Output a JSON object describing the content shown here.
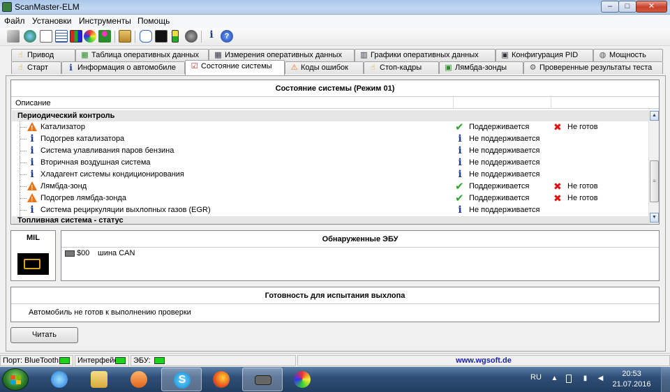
{
  "window": {
    "title": "ScanMaster-ELM",
    "min_glyph": "–",
    "max_glyph": "□",
    "close_glyph": "✕"
  },
  "menu": [
    "Файл",
    "Установки",
    "Инструменты",
    "Помощь"
  ],
  "toolbar_icons": [
    "wrench-icon",
    "globe-icon",
    "document-icon",
    "table-icon",
    "chart-icon",
    "gauge-icon",
    "person-icon",
    "clipboard-icon",
    "chat-icon",
    "terminal-icon",
    "battery-icon",
    "stop-icon",
    "info-icon",
    "help-icon"
  ],
  "tabs_top": [
    {
      "label": "Привод",
      "icon": "gear-hand-icon",
      "glyph": "☝"
    },
    {
      "label": "Таблица оперативных данных",
      "icon": "table-icon",
      "glyph": "▦"
    },
    {
      "label": "Измерения оперативных данных",
      "icon": "grid-icon",
      "glyph": "▦"
    },
    {
      "label": "Графики оперативных данных",
      "icon": "chart-icon",
      "glyph": "▥"
    },
    {
      "label": "Конфигурация PID",
      "icon": "config-icon",
      "glyph": "▣"
    },
    {
      "label": "Мощность",
      "icon": "power-icon",
      "glyph": "◍"
    }
  ],
  "tabs_bottom": [
    {
      "label": "Старт",
      "icon": "start-icon",
      "glyph": "☝",
      "active": false
    },
    {
      "label": "Информация о автомобиле",
      "icon": "info-icon",
      "glyph": "i",
      "active": false
    },
    {
      "label": "Состояние системы",
      "icon": "checklist-icon",
      "glyph": "☑",
      "active": true
    },
    {
      "label": "Коды ошибок",
      "icon": "warning-icon",
      "glyph": "⚠",
      "active": false
    },
    {
      "label": "Стоп-кадры",
      "icon": "snapshot-icon",
      "glyph": "☝",
      "active": false
    },
    {
      "label": "Лямбда-зонды",
      "icon": "lambda-icon",
      "glyph": "▣",
      "active": false
    },
    {
      "label": "Проверенные результаты теста",
      "icon": "gear-icon",
      "glyph": "⚙",
      "active": false
    }
  ],
  "system_status": {
    "title": "Состояние системы (Режим 01)",
    "col_description": "Описание",
    "group1": "Периодический контроль",
    "group2": "Топливная система - статус",
    "rows": [
      {
        "label": "Катализатор",
        "row_icon": "warning-icon",
        "status": "Поддерживается",
        "status_icon": "check-icon",
        "ready": "Не готов",
        "ready_icon": "cross-icon"
      },
      {
        "label": "Подогрев катализатора",
        "row_icon": "info-icon",
        "status": "Не поддерживается",
        "status_icon": "info-icon",
        "ready": "",
        "ready_icon": ""
      },
      {
        "label": "Система улавливания паров бензина",
        "row_icon": "info-icon",
        "status": "Не поддерживается",
        "status_icon": "info-icon",
        "ready": "",
        "ready_icon": ""
      },
      {
        "label": "Вторичная воздушная система",
        "row_icon": "info-icon",
        "status": "Не поддерживается",
        "status_icon": "info-icon",
        "ready": "",
        "ready_icon": ""
      },
      {
        "label": "Хладагент системы кондиционирования",
        "row_icon": "info-icon",
        "status": "Не поддерживается",
        "status_icon": "info-icon",
        "ready": "",
        "ready_icon": ""
      },
      {
        "label": "Лямбда-зонд",
        "row_icon": "warning-icon",
        "status": "Поддерживается",
        "status_icon": "check-icon",
        "ready": "Не готов",
        "ready_icon": "cross-icon"
      },
      {
        "label": "Подогрев лямбда-зонда",
        "row_icon": "warning-icon",
        "status": "Поддерживается",
        "status_icon": "check-icon",
        "ready": "Не готов",
        "ready_icon": "cross-icon"
      },
      {
        "label": "Система рециркуляции выхлопных газов (EGR)",
        "row_icon": "info-icon",
        "status": "Не поддерживается",
        "status_icon": "info-icon",
        "ready": "",
        "ready_icon": ""
      }
    ]
  },
  "mil": {
    "title": "MIL",
    "icon": "check-engine-icon"
  },
  "ecu": {
    "title": "Обнаруженные ЭБУ",
    "address": "$00",
    "bus": "шина CAN"
  },
  "readiness": {
    "title": "Готовность для испытания выхлопа",
    "text": "Автомобиль не готов к выполнению проверки"
  },
  "read_button": "Читать",
  "statusbar": {
    "port": "Порт: BlueTooth",
    "interface": "Интерфейс:",
    "ecu": "ЭБУ:",
    "url": "www.wgsoft.de",
    "led_color": "#19d419"
  },
  "taskbar": {
    "apps": [
      "ie-icon",
      "folder-icon",
      "media-player-icon",
      "skype-icon",
      "firefox-icon",
      "scanmaster-icon",
      "paint-icon"
    ],
    "active_app": "skype-icon",
    "lang": "RU",
    "time": "20:53",
    "date": "21.07.2016"
  }
}
